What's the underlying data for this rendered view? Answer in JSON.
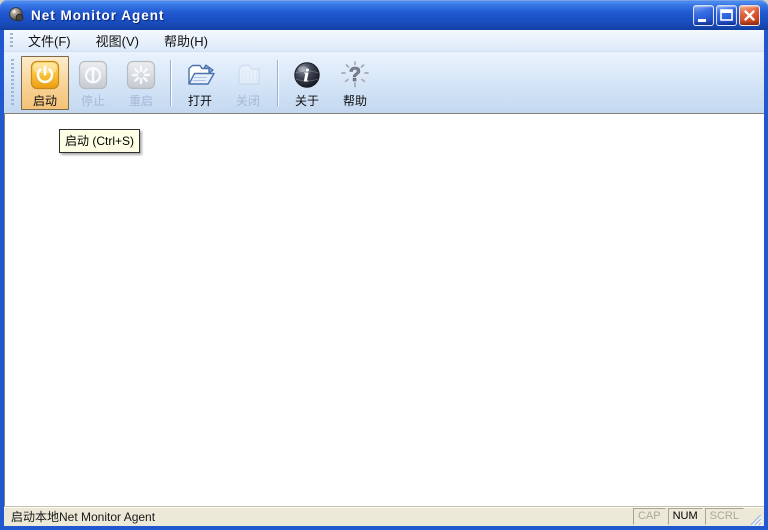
{
  "window": {
    "title": "Net Monitor Agent"
  },
  "menu": {
    "items": [
      {
        "label": "文件(F)"
      },
      {
        "label": "视图(V)"
      },
      {
        "label": "帮助(H)"
      }
    ]
  },
  "toolbar": {
    "buttons": [
      {
        "label": "启动",
        "icon": "power-start-icon",
        "state": "active"
      },
      {
        "label": "停止",
        "icon": "power-stop-icon",
        "state": "disabled"
      },
      {
        "label": "重启",
        "icon": "restart-icon",
        "state": "disabled"
      },
      {
        "label": "打开",
        "icon": "folder-open-icon",
        "state": "normal"
      },
      {
        "label": "关闭",
        "icon": "folder-closed-icon",
        "state": "disabled"
      },
      {
        "label": "关于",
        "icon": "about-globe-icon",
        "state": "normal"
      },
      {
        "label": "帮助",
        "icon": "help-question-icon",
        "state": "normal"
      }
    ]
  },
  "tooltip": {
    "text": "启动 (Ctrl+S)"
  },
  "statusbar": {
    "message": "启动本地Net Monitor Agent",
    "indicators": [
      {
        "label": "CAP",
        "active": false
      },
      {
        "label": "NUM",
        "active": true
      },
      {
        "label": "SCRL",
        "active": false
      }
    ]
  },
  "colors": {
    "titlebar_blue": "#2159d0",
    "window_border": "#2058cf",
    "toolbar_bg": "#d4e4f7",
    "active_button_bg": "#f8d295",
    "active_button_border": "#7c6a48",
    "start_icon_orange": "#f5b325",
    "tooltip_bg": "#ffffe6",
    "statusbar_bg": "#ece9d8",
    "close_button_red": "#cc4418"
  }
}
